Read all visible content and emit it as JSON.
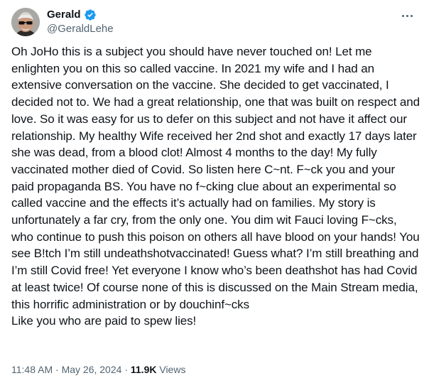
{
  "author": {
    "display_name": "Gerald",
    "handle": "@GeraldLehe"
  },
  "tweet": {
    "text": "Oh JoHo this is a subject you should have never touched on! Let me enlighten you on this so called vaccine. In 2021 my wife and I had an extensive conversation on the vaccine. She decided to get vaccinated, I decided not to. We had a great relationship, one that was built on respect and love. So it was easy for us to defer on this subject and not have it affect our relationship. My healthy Wife received her 2nd shot and exactly 17 days later she was dead, from a blood clot! Almost 4 months to the day! My fully vaccinated mother died of Covid. So listen here C~nt. F~ck you and your paid propaganda BS. You have no f~cking clue about an experimental so called vaccine and the effects it’s actually had on families. My story is unfortunately a far cry, from the only one. You dim wit Fauci loving F~cks, who continue to push this poison on others all have blood on your hands! You see B!tch I’m still undeathshotvaccinated! Guess what? I’m still breathing and I’m still Covid free! Yet everyone I know who’s been deathshot has had Covid at least twice! Of course none of this is discussed on the Main Stream media, this horrific administration or by douchinf~cks\nLike you who are paid to spew lies!"
  },
  "meta": {
    "time": "11:48 AM",
    "separator": "·",
    "date": "May 26, 2024",
    "views_count": "11.9K",
    "views_label": "Views"
  },
  "colors": {
    "verified": "#1d9bf0",
    "secondary_text": "#536471",
    "primary_text": "#0f1419"
  },
  "icons": {
    "verified": "verified-badge-icon",
    "more": "more-horizontal-icon"
  }
}
